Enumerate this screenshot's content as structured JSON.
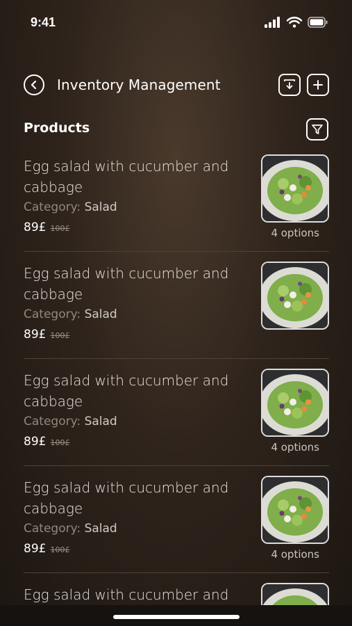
{
  "status_bar": {
    "time": "9:41"
  },
  "header": {
    "title": "Inventory Management"
  },
  "section": {
    "title": "Products"
  },
  "products": [
    {
      "name": "Egg salad with cucumber and cabbage",
      "category_label": "Category:",
      "category": "Salad",
      "price": "89£",
      "old_price": "100£",
      "options": "4 options"
    },
    {
      "name": "Egg salad with cucumber and cabbage",
      "category_label": "Category:",
      "category": "Salad",
      "price": "89£",
      "old_price": "100£",
      "options": ""
    },
    {
      "name": "Egg salad with cucumber and cabbage",
      "category_label": "Category:",
      "category": "Salad",
      "price": "89£",
      "old_price": "100£",
      "options": "4 options"
    },
    {
      "name": "Egg salad with cucumber and cabbage",
      "category_label": "Category:",
      "category": "Salad",
      "price": "89£",
      "old_price": "100£",
      "options": "4 options"
    },
    {
      "name": "Egg salad with cucumber and",
      "category_label": "",
      "category": "",
      "price": "",
      "old_price": "",
      "options": ""
    }
  ],
  "icons": {
    "back": "chevron-left-icon",
    "import": "import-icon",
    "add": "plus-icon",
    "filter": "filter-icon"
  }
}
